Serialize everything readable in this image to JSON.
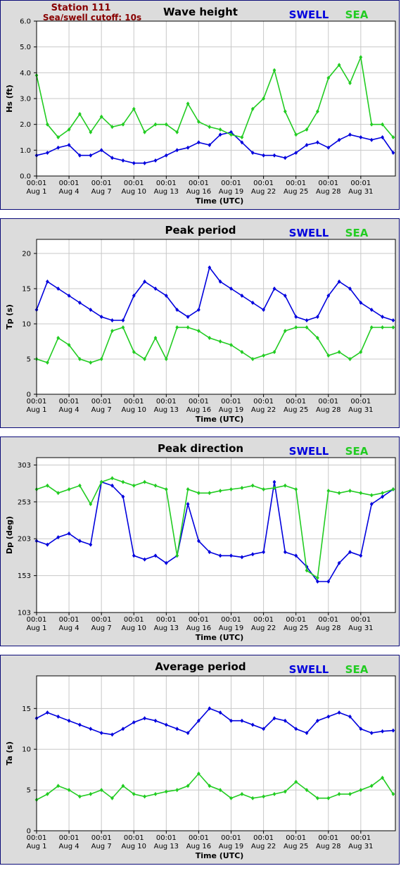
{
  "header": {
    "station": "Station 111",
    "cutoff": "Sea/swell cutoff: 10s"
  },
  "colors": {
    "swell": "#0000dd",
    "sea": "#22cc22",
    "panel_bg": "#dcdcdc",
    "plot_bg": "#ffffff",
    "grid": "#c8c8c8"
  },
  "legend": {
    "swell": "SWELL",
    "sea": "SEA"
  },
  "x_axis": {
    "label": "Time (UTC)",
    "time_label": "00:01",
    "dates": [
      "Aug 1",
      "Aug 4",
      "Aug 7",
      "Aug 10",
      "Aug 13",
      "Aug 16",
      "Aug 19",
      "Aug 22",
      "Aug 25",
      "Aug 28",
      "Aug 31"
    ],
    "day_positions": [
      1,
      4,
      7,
      10,
      13,
      16,
      19,
      22,
      25,
      28,
      31
    ],
    "range": [
      1,
      34.2
    ]
  },
  "chart_data": [
    {
      "type": "line",
      "title": "Wave height",
      "ylabel": "Hs (ft)",
      "ylim": [
        0,
        6
      ],
      "yticks": [
        "0.0",
        "1.0",
        "2.0",
        "3.0",
        "4.0",
        "5.0",
        "6.0"
      ],
      "x": [
        1,
        2,
        3,
        4,
        5,
        6,
        7,
        8,
        9,
        10,
        11,
        12,
        13,
        14,
        15,
        16,
        17,
        18,
        19,
        20,
        21,
        22,
        23,
        24,
        25,
        26,
        27,
        28,
        29,
        30,
        31,
        32,
        33,
        34
      ],
      "series": [
        {
          "name": "SWELL",
          "values": [
            0.8,
            0.9,
            1.1,
            1.2,
            0.8,
            0.8,
            1.0,
            0.7,
            0.6,
            0.5,
            0.5,
            0.6,
            0.8,
            1.0,
            1.1,
            1.3,
            1.2,
            1.6,
            1.7,
            1.3,
            0.9,
            0.8,
            0.8,
            0.7,
            0.9,
            1.2,
            1.3,
            1.1,
            1.4,
            1.6,
            1.5,
            1.4,
            1.5,
            0.9
          ]
        },
        {
          "name": "SEA",
          "values": [
            3.9,
            2.0,
            1.5,
            1.8,
            2.4,
            1.7,
            2.3,
            1.9,
            2.0,
            2.6,
            1.7,
            2.0,
            2.0,
            1.7,
            2.8,
            2.1,
            1.9,
            1.8,
            1.6,
            1.5,
            2.6,
            3.0,
            4.1,
            2.5,
            1.6,
            1.8,
            2.5,
            3.8,
            4.3,
            3.6,
            4.6,
            2.0,
            2.0,
            1.5
          ]
        }
      ]
    },
    {
      "type": "line",
      "title": "Peak period",
      "ylabel": "Tp (s)",
      "ylim": [
        0,
        22
      ],
      "yticks": [
        "0",
        "5",
        "10",
        "15",
        "20"
      ],
      "x": [
        1,
        2,
        3,
        4,
        5,
        6,
        7,
        8,
        9,
        10,
        11,
        12,
        13,
        14,
        15,
        16,
        17,
        18,
        19,
        20,
        21,
        22,
        23,
        24,
        25,
        26,
        27,
        28,
        29,
        30,
        31,
        32,
        33,
        34
      ],
      "series": [
        {
          "name": "SWELL",
          "values": [
            12,
            16,
            15,
            14,
            13,
            12,
            11,
            10.5,
            10.5,
            14,
            16,
            15,
            14,
            12,
            11,
            12,
            18,
            16,
            15,
            14,
            13,
            12,
            15,
            14,
            11,
            10.5,
            11,
            14,
            16,
            15,
            13,
            12,
            11,
            10.5
          ]
        },
        {
          "name": "SEA",
          "values": [
            5,
            4.5,
            8,
            7,
            5,
            4.5,
            5,
            9,
            9.5,
            6,
            5,
            8,
            5,
            9.5,
            9.5,
            9,
            8,
            7.5,
            7,
            6,
            5,
            5.5,
            6,
            9,
            9.5,
            9.5,
            8,
            5.5,
            6,
            5,
            6,
            9.5,
            9.5,
            9.5
          ]
        }
      ]
    },
    {
      "type": "line",
      "title": "Peak direction",
      "ylabel": "Dp (deg)",
      "ylim": [
        103,
        313
      ],
      "yticks": [
        "103",
        "153",
        "203",
        "253",
        "303"
      ],
      "x": [
        1,
        2,
        3,
        4,
        5,
        6,
        7,
        8,
        9,
        10,
        11,
        12,
        13,
        14,
        15,
        16,
        17,
        18,
        19,
        20,
        21,
        22,
        23,
        24,
        25,
        26,
        27,
        28,
        29,
        30,
        31,
        32,
        33,
        34
      ],
      "series": [
        {
          "name": "SWELL",
          "values": [
            200,
            195,
            205,
            210,
            200,
            195,
            280,
            275,
            260,
            180,
            175,
            180,
            170,
            180,
            250,
            200,
            185,
            180,
            180,
            178,
            182,
            185,
            280,
            185,
            180,
            165,
            145,
            145,
            170,
            185,
            180,
            250,
            260,
            270
          ]
        },
        {
          "name": "SEA",
          "values": [
            270,
            275,
            265,
            270,
            275,
            250,
            280,
            285,
            280,
            275,
            280,
            275,
            270,
            180,
            270,
            265,
            265,
            268,
            270,
            272,
            275,
            270,
            272,
            275,
            270,
            160,
            150,
            268,
            265,
            268,
            265,
            262,
            265,
            270
          ]
        }
      ]
    },
    {
      "type": "line",
      "title": "Average period",
      "ylabel": "Ta (s)",
      "ylim": [
        0,
        19
      ],
      "yticks": [
        "0",
        "5",
        "10",
        "15"
      ],
      "x": [
        1,
        2,
        3,
        4,
        5,
        6,
        7,
        8,
        9,
        10,
        11,
        12,
        13,
        14,
        15,
        16,
        17,
        18,
        19,
        20,
        21,
        22,
        23,
        24,
        25,
        26,
        27,
        28,
        29,
        30,
        31,
        32,
        33,
        34
      ],
      "series": [
        {
          "name": "SWELL",
          "values": [
            13.8,
            14.5,
            14.0,
            13.5,
            13.0,
            12.5,
            12.0,
            11.8,
            12.5,
            13.3,
            13.8,
            13.5,
            13.0,
            12.5,
            12.0,
            13.5,
            15.0,
            14.5,
            13.5,
            13.5,
            13.0,
            12.5,
            13.8,
            13.5,
            12.5,
            12.0,
            13.5,
            14.0,
            14.5,
            14.0,
            12.5,
            12.0,
            12.2,
            12.3
          ]
        },
        {
          "name": "SEA",
          "values": [
            3.8,
            4.5,
            5.5,
            5.0,
            4.2,
            4.5,
            5.0,
            4.0,
            5.5,
            4.5,
            4.2,
            4.5,
            4.8,
            5.0,
            5.5,
            7.0,
            5.5,
            5.0,
            4.0,
            4.5,
            4.0,
            4.2,
            4.5,
            4.8,
            6.0,
            5.0,
            4.0,
            4.0,
            4.5,
            4.5,
            5.0,
            5.5,
            6.5,
            4.5
          ]
        }
      ]
    }
  ]
}
